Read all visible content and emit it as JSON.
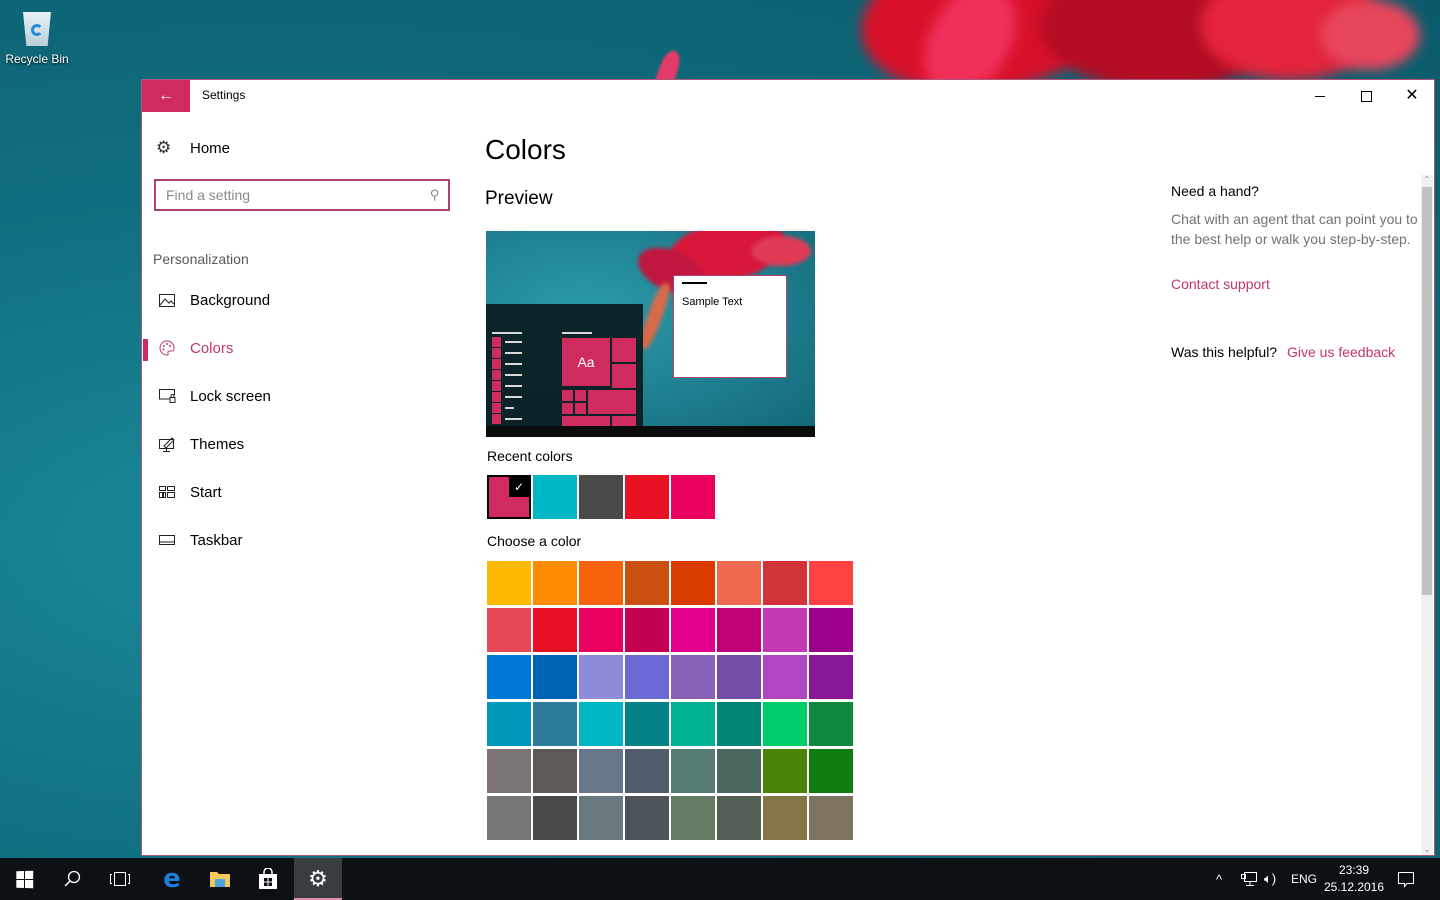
{
  "desktop": {
    "icons": [
      {
        "label": "Recycle Bin",
        "icon": "recycle-bin-icon"
      }
    ]
  },
  "window": {
    "title": "Settings",
    "back_icon": "arrow-left-icon",
    "controls": {
      "minimize": "minimize-icon",
      "maximize": "maximize-icon",
      "close": "close-icon"
    },
    "accent_color": "#cf2b5f"
  },
  "nav": {
    "home": {
      "label": "Home",
      "icon": "gear-icon"
    },
    "search": {
      "placeholder": "Find a setting",
      "value": "",
      "icon": "search-icon"
    },
    "section": "Personalization",
    "items": [
      {
        "label": "Background",
        "icon": "picture-icon",
        "active": false
      },
      {
        "label": "Colors",
        "icon": "palette-icon",
        "active": true
      },
      {
        "label": "Lock screen",
        "icon": "lock-screen-icon",
        "active": false
      },
      {
        "label": "Themes",
        "icon": "themes-icon",
        "active": false
      },
      {
        "label": "Start",
        "icon": "start-tiles-icon",
        "active": false
      },
      {
        "label": "Taskbar",
        "icon": "taskbar-icon",
        "active": false
      }
    ]
  },
  "main": {
    "title": "Colors",
    "preview": {
      "heading": "Preview",
      "tile_text": "Aa",
      "sample_text": "Sample Text"
    },
    "recent_colors": {
      "label": "Recent colors",
      "swatches": [
        "#cf2b5f",
        "#00b7c3",
        "#4c4a48",
        "#e81123",
        "#ea005e"
      ],
      "selected_index": 0
    },
    "choose_color": {
      "label": "Choose a color",
      "swatches": [
        "#ffb900",
        "#ff8c00",
        "#f7630c",
        "#ca5010",
        "#da3b01",
        "#ef6950",
        "#d13438",
        "#ff4343",
        "#e74856",
        "#e81123",
        "#ea005e",
        "#c30052",
        "#e3008c",
        "#bf0077",
        "#c239b3",
        "#9a0089",
        "#0078d7",
        "#0063b1",
        "#8e8cd8",
        "#6b69d6",
        "#8764b8",
        "#744da9",
        "#b146c2",
        "#881798",
        "#0099bc",
        "#2d7d9a",
        "#00b7c3",
        "#038387",
        "#00b294",
        "#018574",
        "#00cc6a",
        "#10893e",
        "#7a7574",
        "#5d5a58",
        "#68768a",
        "#515c6b",
        "#567c73",
        "#486860",
        "#498205",
        "#107c10",
        "#767676",
        "#4c4a48",
        "#69797e",
        "#4a5459",
        "#647c64",
        "#525e54",
        "#847545",
        "#7e735f"
      ]
    }
  },
  "help": {
    "heading": "Need a hand?",
    "body": "Chat with an agent that can point you to the best help or walk you step-by-step.",
    "contact_link": "Contact support",
    "helpful_label": "Was this helpful?",
    "feedback_link": "Give us feedback"
  },
  "taskbar": {
    "buttons": [
      {
        "name": "start",
        "icon": "windows-logo-icon"
      },
      {
        "name": "search",
        "icon": "search-icon"
      },
      {
        "name": "task-view",
        "icon": "task-view-icon"
      },
      {
        "name": "edge",
        "icon": "edge-browser-icon"
      },
      {
        "name": "file-explorer",
        "icon": "folder-icon"
      },
      {
        "name": "store",
        "icon": "store-bag-icon"
      },
      {
        "name": "settings",
        "icon": "gear-icon",
        "active": true
      }
    ],
    "tray": {
      "chevron": "^",
      "language": "ENG",
      "time": "23:39",
      "date": "25.12.2016"
    }
  }
}
